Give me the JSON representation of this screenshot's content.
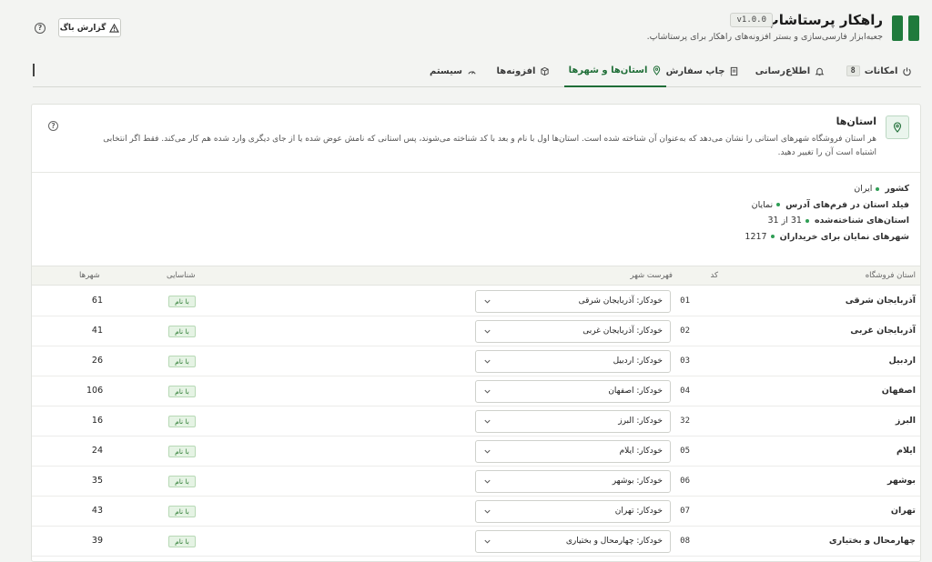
{
  "header": {
    "title": "راهکار پرستاشاپ",
    "version": "v1.0.0",
    "subtitle": "جعبه‌ابزار فارسی‌سازی و بستر افزونه‌های راهکار برای پرستاشاپ.",
    "bug_report_label": "گزارش باگ",
    "help_icon": "help-circle-icon",
    "brand_color": "#1f7a3c"
  },
  "tabs": [
    {
      "label": "امکانات",
      "badge": "8",
      "icon": "power-icon",
      "active": false
    },
    {
      "label": "اطلاع‌رسانی",
      "icon": "bell-icon",
      "active": false
    },
    {
      "label": "چاپ سفارش",
      "icon": "document-icon",
      "active": false
    },
    {
      "label": "استان‌ها و شهرها",
      "icon": "map-pin-icon",
      "active": true
    },
    {
      "label": "افزونه‌ها",
      "icon": "cube-icon",
      "active": false
    },
    {
      "label": "سیستم",
      "icon": "gauge-icon",
      "active": false
    }
  ],
  "section": {
    "title": "استان‌ها",
    "description": "هر استان فروشگاه شهرهای استانی را نشان می‌دهد که به‌عنوان آن شناخته شده است. استان‌ها اول با نام و بعد با کد شناخته می‌شوند، پس استانی که نامش عوض شده یا از جای دیگری وارد شده هم کار می‌کند. فقط اگر انتخابی اشتباه است آن را تغییر دهید."
  },
  "summary": [
    {
      "label": "کشور",
      "value": "ایران"
    },
    {
      "label": "فیلد استان در فرم‌های آدرس",
      "value": "نمایان"
    },
    {
      "label": "استان‌های شناخته‌شده",
      "value": "31 از 31"
    },
    {
      "label": "شهرهای نمایان برای خریداران",
      "value": "1217"
    }
  ],
  "table": {
    "headers": {
      "state": "استان فروشگاه",
      "code": "کد",
      "city_list": "فهرست شهر",
      "recognition": "شناسایی",
      "cities": "شهرها"
    },
    "rows": [
      {
        "state": "آذربایجان شرقی",
        "code": "01",
        "city_list": "خودکار: آذربایجان شرقی",
        "recognition": "با نام",
        "cities": "61"
      },
      {
        "state": "آذربایجان غربی",
        "code": "02",
        "city_list": "خودکار: آذربایجان غربی",
        "recognition": "با نام",
        "cities": "41"
      },
      {
        "state": "اردبیل",
        "code": "03",
        "city_list": "خودکار: اردبیل",
        "recognition": "با نام",
        "cities": "26"
      },
      {
        "state": "اصفهان",
        "code": "04",
        "city_list": "خودکار: اصفهان",
        "recognition": "با نام",
        "cities": "106"
      },
      {
        "state": "البرز",
        "code": "32",
        "city_list": "خودکار: البرز",
        "recognition": "با نام",
        "cities": "16"
      },
      {
        "state": "ایلام",
        "code": "05",
        "city_list": "خودکار: ایلام",
        "recognition": "با نام",
        "cities": "24"
      },
      {
        "state": "بوشهر",
        "code": "06",
        "city_list": "خودکار: بوشهر",
        "recognition": "با نام",
        "cities": "35"
      },
      {
        "state": "تهران",
        "code": "07",
        "city_list": "خودکار: تهران",
        "recognition": "با نام",
        "cities": "43"
      },
      {
        "state": "چهارمحال و بختیاری",
        "code": "08",
        "city_list": "خودکار: چهارمحال و بختیاری",
        "recognition": "با نام",
        "cities": "39"
      }
    ]
  }
}
